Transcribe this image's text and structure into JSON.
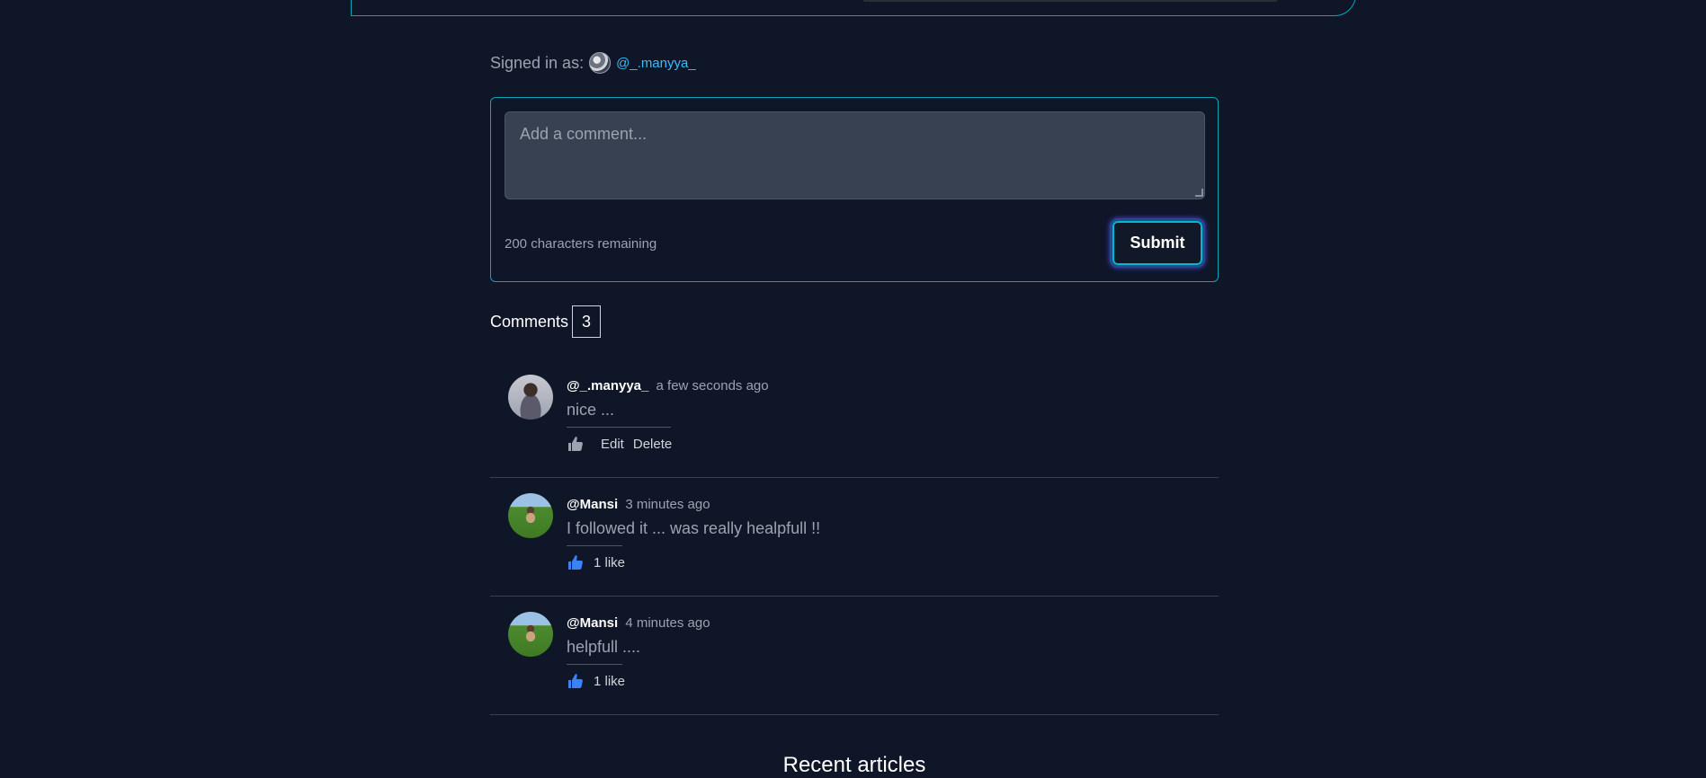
{
  "signed_in": {
    "label": "Signed in as:",
    "username": "@_.manyya_"
  },
  "comment_form": {
    "placeholder": "Add a comment...",
    "remaining": "200 characters remaining",
    "submit_label": "Submit"
  },
  "comments_section": {
    "title": "Comments",
    "count": "3",
    "items": [
      {
        "user": "@_.manyya_",
        "time": "a few seconds ago",
        "text": "nice ...",
        "edit_label": "Edit",
        "delete_label": "Delete",
        "like_icon": "thumbs-up-icon",
        "liked": false
      },
      {
        "user": "@Mansi",
        "time": "3 minutes ago",
        "text": "I followed it ... was really healpfull !!",
        "likes": "1 like",
        "like_icon": "thumbs-up-icon",
        "liked": true
      },
      {
        "user": "@Mansi",
        "time": "4 minutes ago",
        "text": "helpfull ....",
        "likes": "1 like",
        "like_icon": "thumbs-up-icon",
        "liked": true
      }
    ]
  },
  "recent_articles": {
    "title": "Recent articles"
  },
  "colors": {
    "background": "#0f1628",
    "accent": "#0ea5b7",
    "link": "#38bdf8",
    "like_active": "#3b82f6",
    "like_inactive": "#9ca3af"
  }
}
